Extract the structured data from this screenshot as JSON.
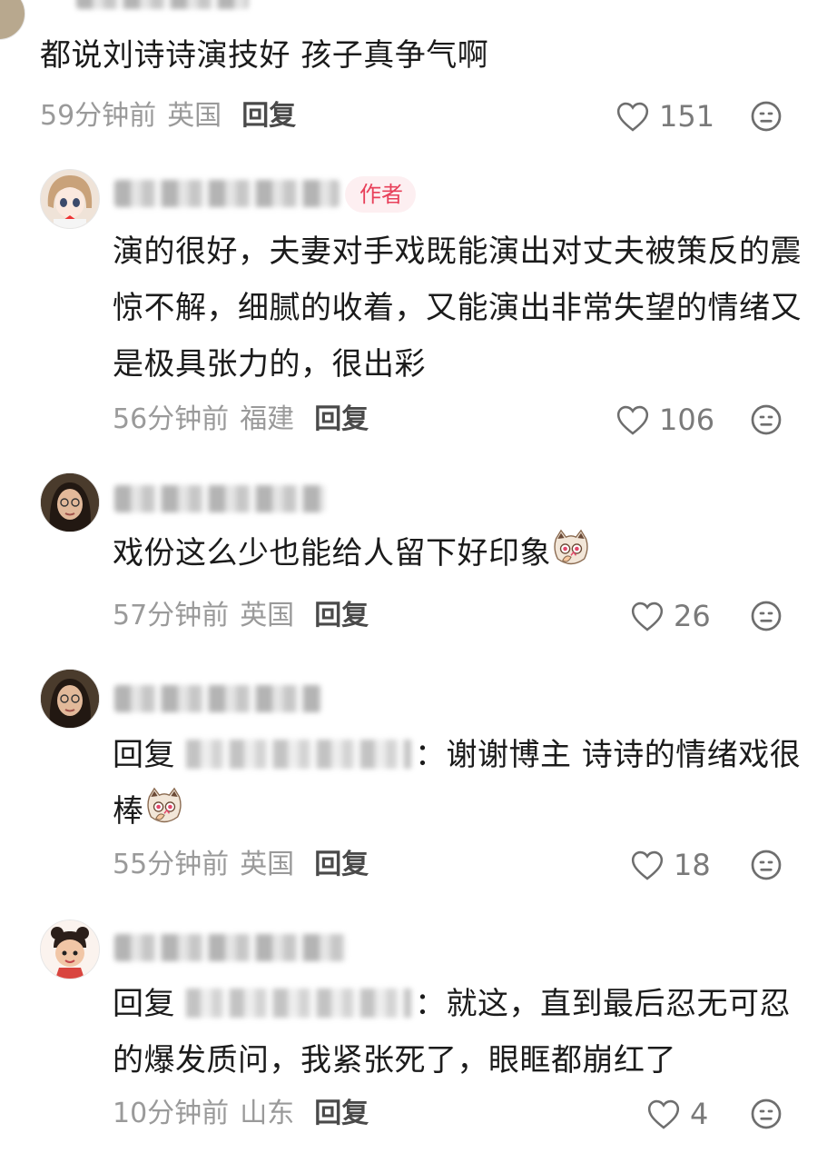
{
  "comments": [
    {
      "text": "都说刘诗诗演技好 孩子真争气啊",
      "time": "59分钟前",
      "place": "英国",
      "reply": "回复",
      "likes": "151"
    },
    {
      "author_badge": "作者",
      "text": "演的很好，夫妻对手戏既能演出对丈夫被策反的震惊不解，细腻的收着，又能演出非常失望的情绪又是极具张力的，很出彩",
      "time": "56分钟前",
      "place": "福建",
      "reply": "回复",
      "likes": "106"
    },
    {
      "text": "戏份这么少也能给人留下好印象",
      "time": "57分钟前",
      "place": "英国",
      "reply": "回复",
      "likes": "26"
    },
    {
      "reply_prefix": "回复",
      "text": "：谢谢博主 诗诗的情绪戏很棒",
      "time": "55分钟前",
      "place": "英国",
      "reply": "回复",
      "likes": "18"
    },
    {
      "reply_prefix": "回复",
      "text": "：就这，直到最后忍无可忍的爆发质问，我紧张死了，眼眶都崩红了",
      "time": "10分钟前",
      "place": "山东",
      "reply": "回复",
      "likes": "4"
    }
  ],
  "icons": {
    "like": "heart-outline-icon",
    "dislike": "neutral-face-icon",
    "emoji": "cat-emoji-icon"
  },
  "colors": {
    "accent": "#e8405a",
    "meta": "#9a9a9a",
    "text": "#1b1b1b"
  }
}
